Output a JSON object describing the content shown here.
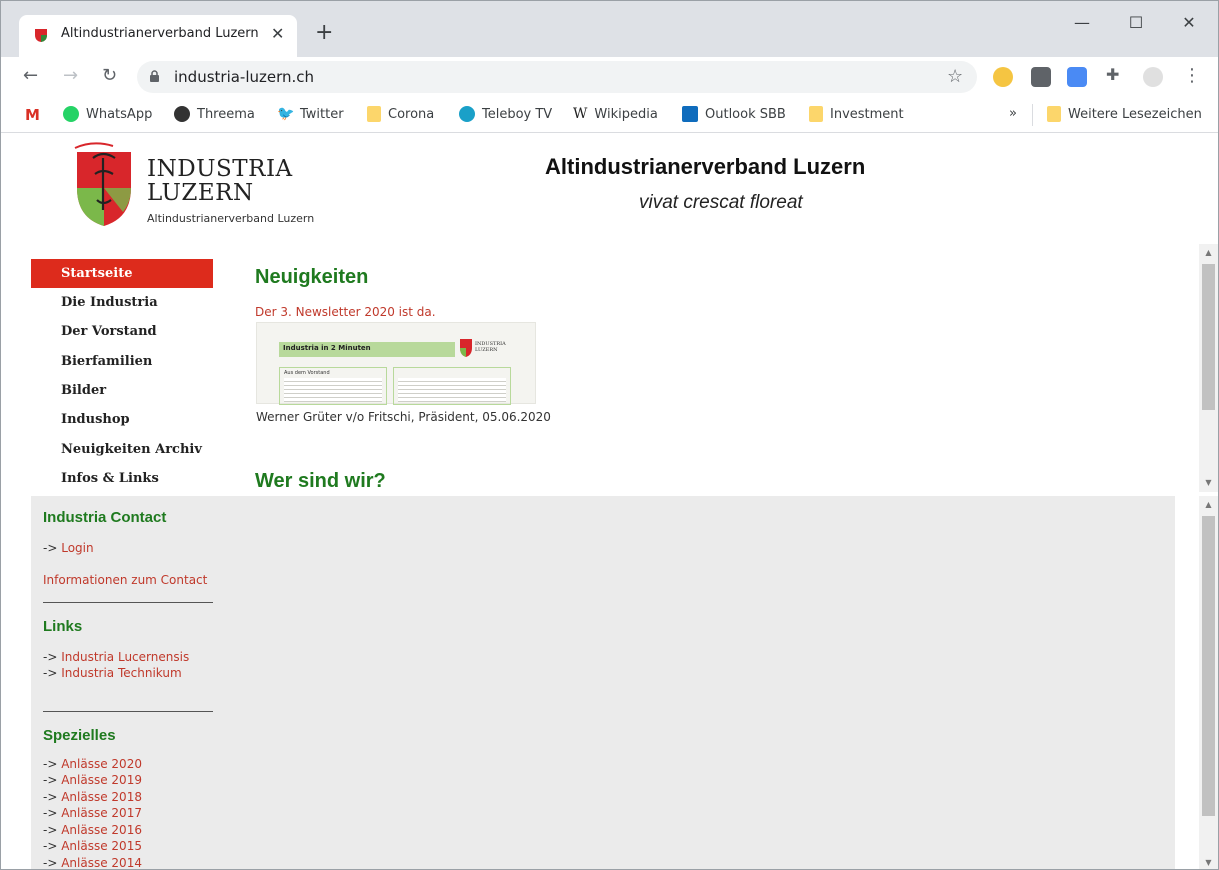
{
  "browser": {
    "tab_title": "Altindustrianerverband Luzern",
    "tab_close": "✕",
    "new_tab": "+",
    "window_minimize": "—",
    "window_maximize": "☐",
    "window_close": "✕",
    "url": "industria-luzern.ch",
    "bookmarks": [
      {
        "label": "WhatsApp",
        "icon": "whatsapp-icon"
      },
      {
        "label": "Threema",
        "icon": "threema-icon"
      },
      {
        "label": "Twitter",
        "icon": "twitter-icon"
      },
      {
        "label": "Corona",
        "icon": "folder-icon"
      },
      {
        "label": "Teleboy TV",
        "icon": "teleboy-icon"
      },
      {
        "label": "Wikipedia",
        "icon": "wikipedia-icon"
      },
      {
        "label": "Outlook SBB",
        "icon": "outlook-icon"
      },
      {
        "label": "Investment",
        "icon": "folder-icon"
      }
    ],
    "bookmarks_overflow": "»",
    "other_bookmarks": "Weitere Lesezeichen",
    "colors": {
      "tabstrip": "#dee1e6",
      "omnibox": "#f1f3f4"
    }
  },
  "header": {
    "logo_line1": "INDUSTRIA",
    "logo_line2": "LUZERN",
    "logo_subtitle": "Altindustrianerverband Luzern",
    "title": "Altindustrianerverband Luzern",
    "motto": "vivat crescat floreat"
  },
  "menu": {
    "items": [
      {
        "label": "Startseite",
        "active": true
      },
      {
        "label": "Die Industria"
      },
      {
        "label": "Der Vorstand"
      },
      {
        "label": "Bierfamilien"
      },
      {
        "label": "Bilder"
      },
      {
        "label": "Indushop"
      },
      {
        "label": "Neuigkeiten Archiv"
      },
      {
        "label": "Infos & Links"
      }
    ]
  },
  "news": {
    "heading": "Neuigkeiten",
    "link": "Der 3. Newsletter 2020 ist da.",
    "thumbnail_title": "Industria in 2 Minuten",
    "thumbnail_logo_1": "INDUSTRIA",
    "thumbnail_logo_2": "LUZERN",
    "thumbnail_box": "Aus dem Vorstand",
    "author": "Werner Grüter v/o Fritschi, Präsident, 05.06.2020",
    "next_heading": "Wer sind wir?"
  },
  "sidebar": {
    "contact_heading": "Industria Contact",
    "arrow": "->",
    "login": "Login",
    "contact_info": "Informationen zum Contact",
    "links_heading": "Links",
    "links": [
      "Industria Lucernensis",
      "Industria Technikum"
    ],
    "special_heading": "Spezielles",
    "special": [
      "Anlässe 2020",
      "Anlässe 2019",
      "Anlässe 2018",
      "Anlässe 2017",
      "Anlässe 2016",
      "Anlässe 2015",
      "Anlässe 2014"
    ]
  },
  "colors": {
    "accent_green": "#1f7a1f",
    "menu_active": "#dd2b1c",
    "link_red": "#c0392b",
    "lower_frame_bg": "#ebebeb"
  }
}
